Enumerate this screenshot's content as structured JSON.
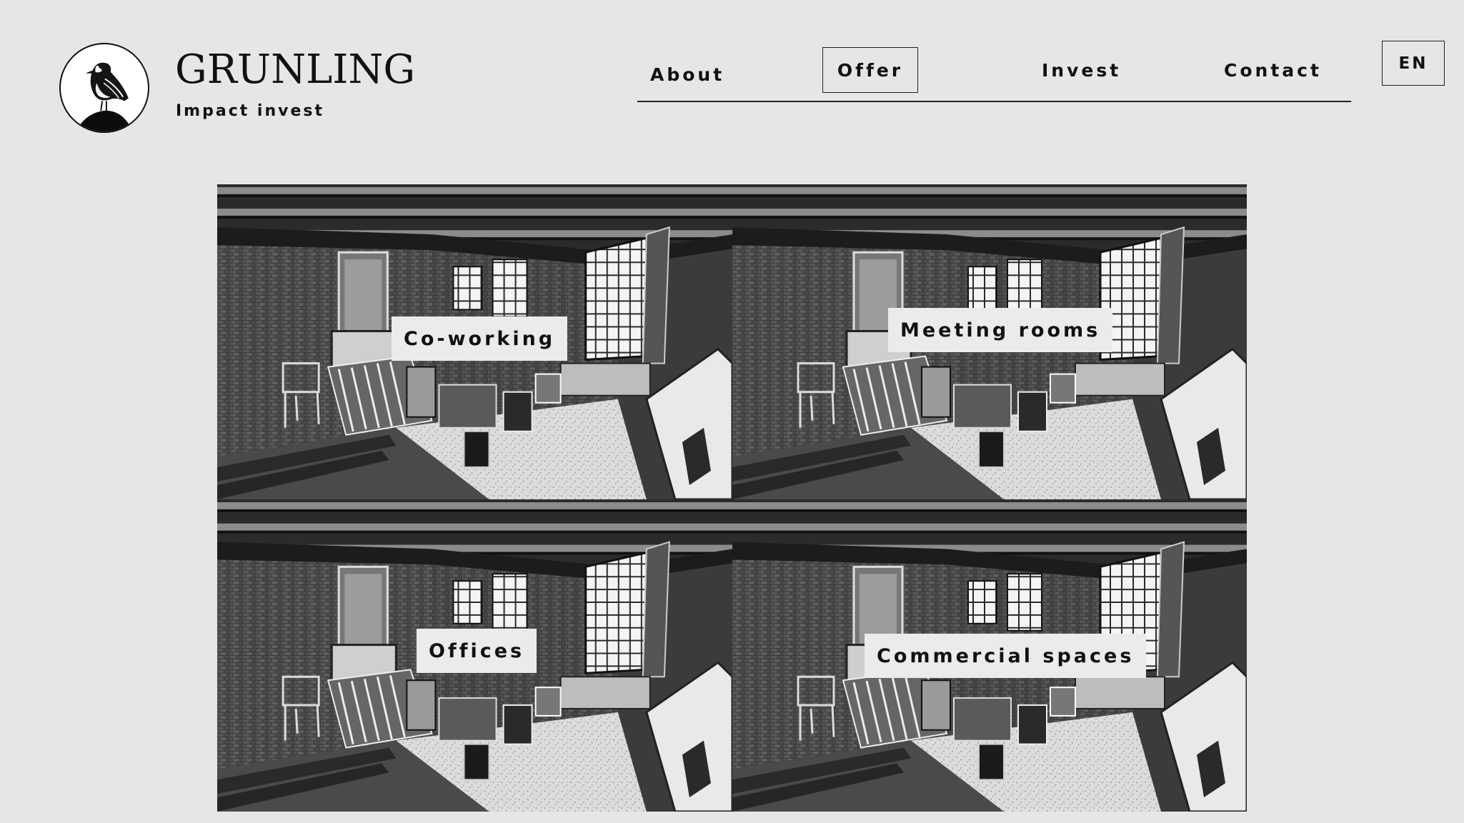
{
  "brand": {
    "name": "GRUNLING",
    "tagline": "Impact invest",
    "logo_icon": "sparrow-on-rock-icon"
  },
  "nav": {
    "items": [
      {
        "label": "About",
        "active": false
      },
      {
        "label": "Offer",
        "active": true
      },
      {
        "label": "Invest",
        "active": false
      },
      {
        "label": "Contact",
        "active": false
      }
    ],
    "language": "EN"
  },
  "offer": {
    "tiles": [
      {
        "label": "Co-working"
      },
      {
        "label": "Meeting rooms"
      },
      {
        "label": "Offices"
      },
      {
        "label": "Commercial spaces"
      }
    ]
  },
  "colors": {
    "background": "#e7e5e6",
    "text": "#111111",
    "label_background": "#ecebea"
  }
}
